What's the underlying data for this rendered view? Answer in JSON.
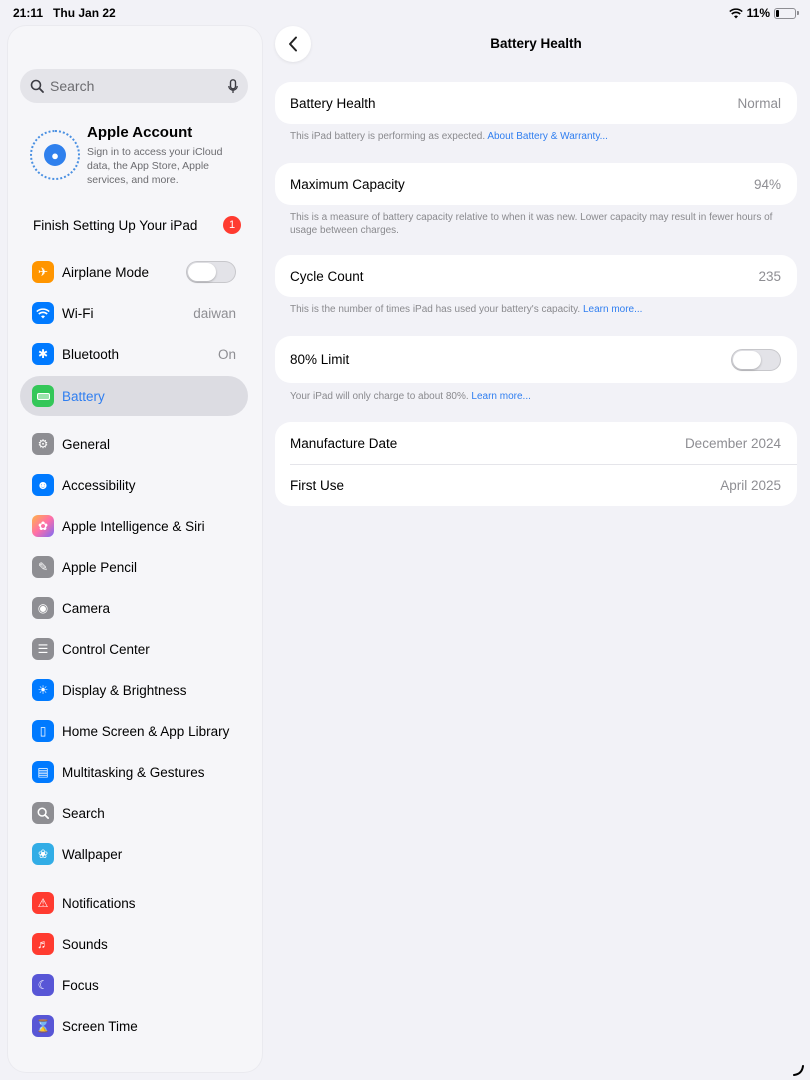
{
  "status_bar": {
    "time": "21:11",
    "date": "Thu Jan 22",
    "battery": "11%"
  },
  "sidebar": {
    "search_placeholder": "Search",
    "account": {
      "title": "Apple Account",
      "subtitle": "Sign in to access your iCloud data, the App Store, Apple services, and more."
    },
    "finish_setup": {
      "label": "Finish Setting Up Your iPad",
      "badge": "1"
    },
    "items": [
      {
        "label": "Airplane Mode",
        "icon": "airplane-icon",
        "color": "#ff9500"
      },
      {
        "label": "Wi-Fi",
        "value": "daiwan",
        "icon": "wifi-icon",
        "color": "#007aff"
      },
      {
        "label": "Bluetooth",
        "value": "On",
        "icon": "bluetooth-icon",
        "color": "#007aff"
      },
      {
        "label": "Battery",
        "icon": "battery-icon",
        "color": "#34c759"
      },
      {
        "label": "General",
        "icon": "gear-icon",
        "color": "#8e8e93"
      },
      {
        "label": "Accessibility",
        "icon": "accessibility-icon",
        "color": "#007aff"
      },
      {
        "label": "Apple Intelligence & Siri",
        "icon": "siri-icon",
        "color": "#ff6fa8"
      },
      {
        "label": "Apple Pencil",
        "icon": "pencil-icon",
        "color": "#8e8e93"
      },
      {
        "label": "Camera",
        "icon": "camera-icon",
        "color": "#8e8e93"
      },
      {
        "label": "Control Center",
        "icon": "control-center-icon",
        "color": "#8e8e93"
      },
      {
        "label": "Display & Brightness",
        "icon": "brightness-icon",
        "color": "#007aff"
      },
      {
        "label": "Home Screen & App Library",
        "icon": "home-screen-icon",
        "color": "#007aff"
      },
      {
        "label": "Multitasking & Gestures",
        "icon": "multitasking-icon",
        "color": "#007aff"
      },
      {
        "label": "Search",
        "icon": "search-icon",
        "color": "#8e8e93"
      },
      {
        "label": "Wallpaper",
        "icon": "wallpaper-icon",
        "color": "#32ade6"
      },
      {
        "label": "Notifications",
        "icon": "bell-icon",
        "color": "#ff3b30"
      },
      {
        "label": "Sounds",
        "icon": "speaker-icon",
        "color": "#ff3b30"
      },
      {
        "label": "Focus",
        "icon": "moon-icon",
        "color": "#5856d6"
      },
      {
        "label": "Screen Time",
        "icon": "hourglass-icon",
        "color": "#5856d6"
      }
    ]
  },
  "main": {
    "title": "Battery Health",
    "battery_health": {
      "label": "Battery Health",
      "value": "Normal",
      "note": "This iPad battery is performing as expected.",
      "link": "About Battery & Warranty..."
    },
    "max_capacity": {
      "label": "Maximum Capacity",
      "value": "94%",
      "note": "This is a measure of battery capacity relative to when it was new. Lower capacity may result in fewer hours of usage between charges."
    },
    "cycle_count": {
      "label": "Cycle Count",
      "value": "235",
      "note": "This is the number of times iPad has used your battery's capacity.",
      "link": "Learn more..."
    },
    "limit": {
      "label": "80% Limit",
      "note": "Your iPad will only charge to about 80%.",
      "link": "Learn more..."
    },
    "manufacture": {
      "label": "Manufacture Date",
      "value": "December 2024"
    },
    "first_use": {
      "label": "First Use",
      "value": "April 2025"
    }
  }
}
